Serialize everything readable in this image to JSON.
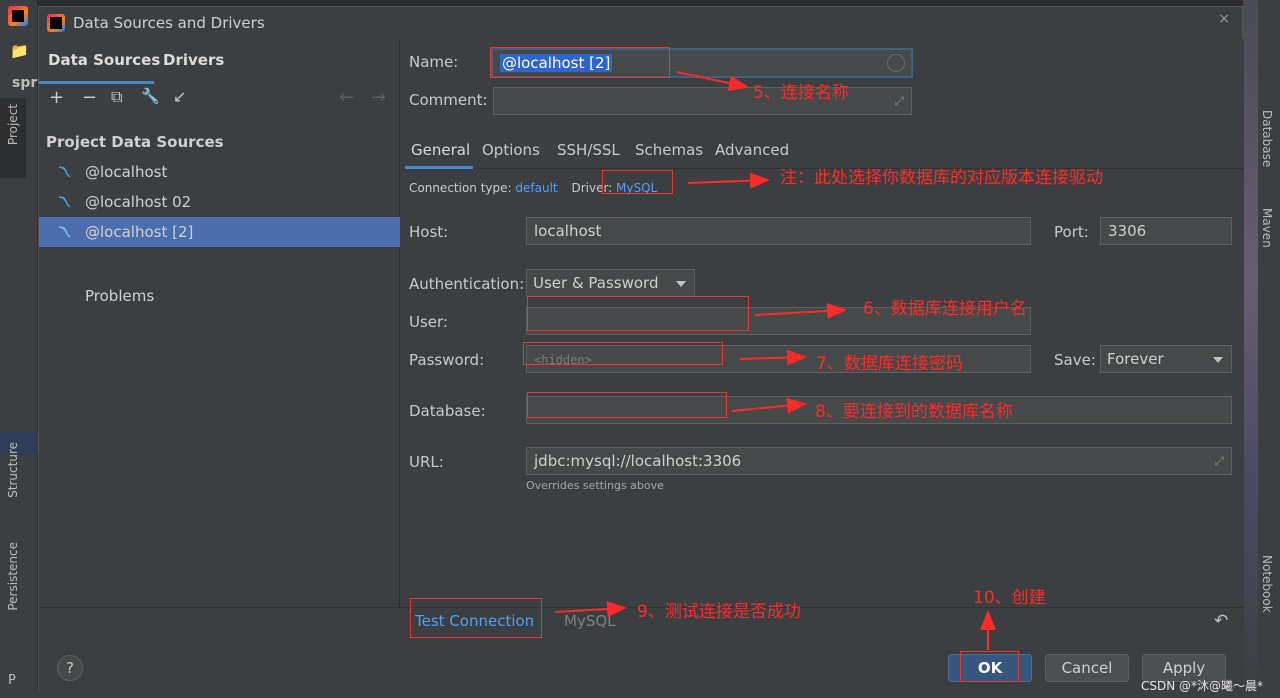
{
  "ide": {
    "project_short": "spr",
    "left_tabs": [
      "Project",
      "Structure",
      "Persistence"
    ],
    "right_tabs": [
      "Database",
      "Maven",
      "Notebook"
    ],
    "bottom_left": "P"
  },
  "dialog": {
    "title": "Data Sources and Drivers",
    "close": "×"
  },
  "left": {
    "tabs": [
      "Data Sources",
      "Drivers"
    ],
    "toolbar": {
      "add": "+",
      "remove": "−",
      "copy": "⧉",
      "settings": "🔧",
      "import": "↙",
      "back": "←",
      "forward": "→"
    },
    "section_title": "Project Data Sources",
    "items": [
      {
        "label": "@localhost"
      },
      {
        "label": "@localhost 02"
      },
      {
        "label": "@localhost [2]"
      }
    ],
    "problems": "Problems"
  },
  "form": {
    "name_label": "Name:",
    "name_value": "@localhost [2]",
    "comment_label": "Comment:",
    "comment_value": "",
    "tabs": [
      "General",
      "Options",
      "SSH/SSL",
      "Schemas",
      "Advanced"
    ],
    "connection_type_label": "Connection type:",
    "connection_type_value": "default",
    "driver_label": "Driver:",
    "driver_value": "MySQL",
    "host_label": "Host:",
    "host_value": "localhost",
    "port_label": "Port:",
    "port_value": "3306",
    "auth_label": "Authentication:",
    "auth_value": "User & Password",
    "user_label": "User:",
    "user_value": "",
    "password_label": "Password:",
    "password_placeholder": "<hidden>",
    "save_label": "Save:",
    "save_value": "Forever",
    "database_label": "Database:",
    "database_value": "",
    "url_label": "URL:",
    "url_value": "jdbc:mysql://localhost:3306",
    "url_hint": "Overrides settings above"
  },
  "footer": {
    "test_connection": "Test Connection",
    "driver_name": "MySQL",
    "undo": "↶",
    "help": "?",
    "ok": "OK",
    "cancel": "Cancel",
    "apply": "Apply"
  },
  "annotations": {
    "a5": "5、连接名称",
    "note": "注：此处选择你数据库的对应版本连接驱动",
    "a6": "6、数据库连接用户名",
    "a7": "7、数据库连接密码",
    "a8": "8、要连接到的数据库名称",
    "a9": "9、测试连接是否成功",
    "a10": "10、创建"
  },
  "watermark": "CSDN @*沐@曦～晨*",
  "colors": {
    "accent": "#4a88c7",
    "selection": "#4b6eaf",
    "link": "#589df6",
    "annotation": "#ff2a2a",
    "primary_button": "#365880"
  }
}
